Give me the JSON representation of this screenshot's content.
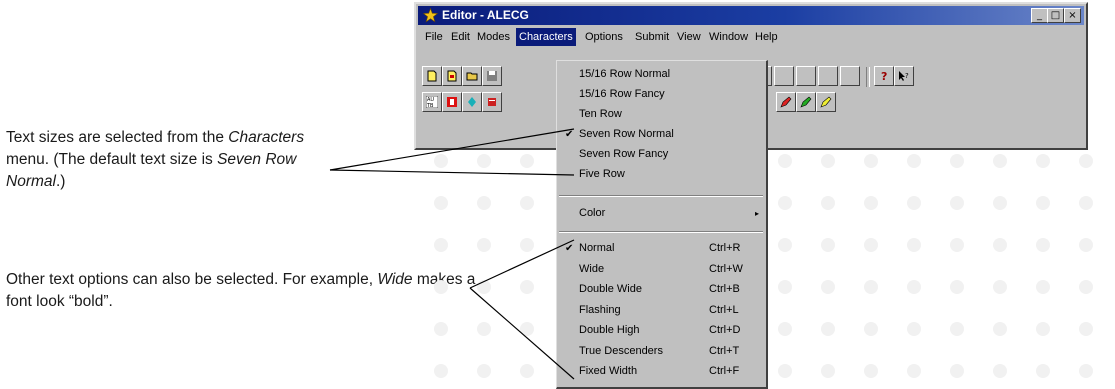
{
  "window": {
    "title": "Editor - ALECG",
    "controls": [
      "_",
      "□",
      "×"
    ]
  },
  "menubar": {
    "items": [
      "File",
      "Edit",
      "Modes",
      "Characters",
      "Options",
      "Submit",
      "View",
      "Window",
      "Help"
    ],
    "active": "Characters"
  },
  "characters_menu": {
    "size_items": [
      {
        "label": "15/16 Row Normal",
        "checked": false
      },
      {
        "label": "15/16 Row Fancy",
        "checked": false
      },
      {
        "label": "Ten Row",
        "checked": false
      },
      {
        "label": "Seven Row Normal",
        "checked": true
      },
      {
        "label": "Seven Row Fancy",
        "checked": false
      },
      {
        "label": "Five Row",
        "checked": false
      }
    ],
    "color_item": "Color",
    "option_items": [
      {
        "label": "Normal",
        "shortcut": "Ctrl+R",
        "checked": true
      },
      {
        "label": "Wide",
        "shortcut": "Ctrl+W",
        "checked": false
      },
      {
        "label": "Double Wide",
        "shortcut": "Ctrl+B",
        "checked": false
      },
      {
        "label": "Flashing",
        "shortcut": "Ctrl+L",
        "checked": false
      },
      {
        "label": "Double High",
        "shortcut": "Ctrl+D",
        "checked": false
      },
      {
        "label": "True Descenders",
        "shortcut": "Ctrl+T",
        "checked": false
      },
      {
        "label": "Fixed Width",
        "shortcut": "Ctrl+F",
        "checked": false
      }
    ],
    "check_glyph": "✔",
    "submenu_arrow": "▸"
  },
  "annotations": {
    "note1": {
      "p1": "Text sizes are selected from the ",
      "p2": "Characters",
      "p3": " menu. (The default text size is ",
      "p4": "Seven Row Normal",
      "p5": ".)"
    },
    "note2": {
      "p1": "Other text options can also be selected. For example, ",
      "p2": "Wide",
      "p3": " makes a font look “bold”."
    }
  },
  "colors": {
    "titlebar": "#0a1b7a",
    "menu_highlight": "#0a1b7a",
    "face": "#c0c0c0"
  },
  "icons": [
    "star-app-icon",
    "new-file-icon",
    "open-folder-icon",
    "save-icon",
    "key-icon",
    "help-pointer-icon",
    "pencil-red-icon",
    "pencil-green-icon",
    "pencil-yellow-icon"
  ]
}
